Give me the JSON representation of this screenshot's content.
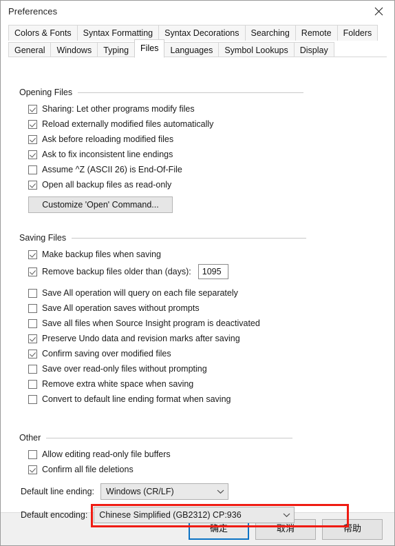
{
  "window": {
    "title": "Preferences",
    "close_icon": "close-icon"
  },
  "tabs": {
    "row1": [
      {
        "label": "Colors & Fonts",
        "selected": false
      },
      {
        "label": "Syntax Formatting",
        "selected": false
      },
      {
        "label": "Syntax Decorations",
        "selected": false
      },
      {
        "label": "Searching",
        "selected": false
      },
      {
        "label": "Remote",
        "selected": false
      },
      {
        "label": "Folders",
        "selected": false
      }
    ],
    "row2": [
      {
        "label": "General",
        "selected": false
      },
      {
        "label": "Windows",
        "selected": false
      },
      {
        "label": "Typing",
        "selected": false
      },
      {
        "label": "Files",
        "selected": true
      },
      {
        "label": "Languages",
        "selected": false
      },
      {
        "label": "Symbol Lookups",
        "selected": false
      },
      {
        "label": "Display",
        "selected": false
      }
    ]
  },
  "groups": {
    "opening_files": {
      "title": "Opening Files",
      "checkboxes": [
        {
          "label": "Sharing: Let other programs modify files",
          "checked": true
        },
        {
          "label": "Reload externally modified files automatically",
          "checked": true
        },
        {
          "label": "Ask before reloading modified files",
          "checked": true
        },
        {
          "label": "Ask to fix inconsistent line endings",
          "checked": true
        },
        {
          "label": "Assume ^Z (ASCII 26) is End-Of-File",
          "checked": false
        },
        {
          "label": "Open all backup files as read-only",
          "checked": true
        }
      ],
      "customize_button": "Customize 'Open' Command..."
    },
    "saving_files": {
      "title": "Saving Files",
      "checkboxes_top": [
        {
          "label": "Make backup files when saving",
          "checked": true
        }
      ],
      "remove_backup": {
        "label": "Remove backup files older than (days):",
        "checked": true,
        "value": "1095"
      },
      "checkboxes_bottom": [
        {
          "label": "Save All operation will query on each file separately",
          "checked": false
        },
        {
          "label": "Save All operation saves without prompts",
          "checked": false
        },
        {
          "label": "Save all files when Source Insight program is deactivated",
          "checked": false
        },
        {
          "label": "Preserve Undo data and revision marks after saving",
          "checked": true
        },
        {
          "label": "Confirm saving over modified files",
          "checked": true
        },
        {
          "label": "Save over read-only files without prompting",
          "checked": false
        },
        {
          "label": "Remove extra white space when saving",
          "checked": false
        },
        {
          "label": "Convert to default line ending format when saving",
          "checked": false
        }
      ]
    },
    "other": {
      "title": "Other",
      "checkboxes": [
        {
          "label": "Allow editing read-only file buffers",
          "checked": false
        },
        {
          "label": "Confirm all file deletions",
          "checked": true
        }
      ],
      "default_line_ending": {
        "label": "Default line ending:",
        "value": "Windows (CR/LF)"
      },
      "default_encoding": {
        "label": "Default encoding:",
        "value": "Chinese Simplified (GB2312)  CP:936",
        "highlight_color": "#ef1b12"
      }
    }
  },
  "footer": {
    "ok": "确定",
    "cancel": "取消",
    "help": "帮助"
  }
}
